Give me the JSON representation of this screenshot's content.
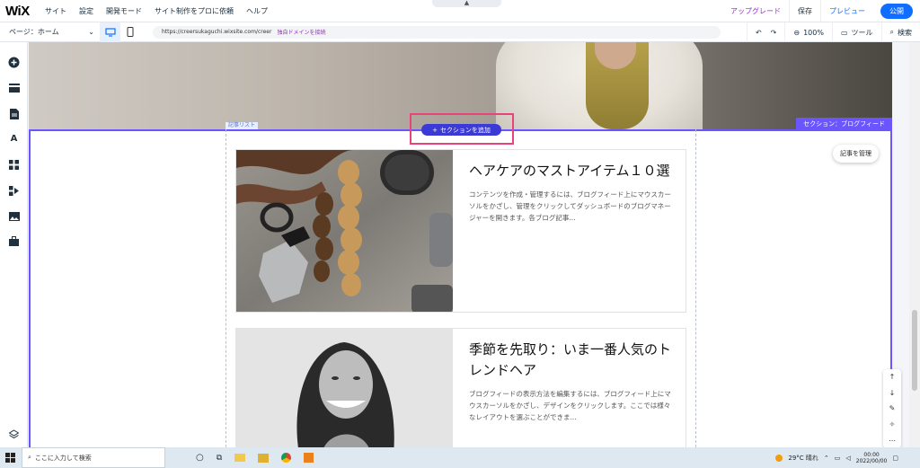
{
  "topbar": {
    "logo": "WiX",
    "menu": [
      "サイト",
      "設定",
      "開発モード",
      "サイト制作をプロに依頼",
      "ヘルプ"
    ],
    "upgrade": "アップグレード",
    "save": "保存",
    "preview": "プレビュー",
    "publish": "公開"
  },
  "subbar": {
    "page": "ページ：ホーム",
    "url": "https://creersukaguchi.wixsite.com/creer",
    "connect_domain": "独自ドメインを接続",
    "zoom": "100%",
    "tools": "ツール",
    "search": "検索"
  },
  "canvas": {
    "section_label": "セクション：ブログフィード",
    "list_label": "記事リスト",
    "add_section": "セクションを追加",
    "manage_posts": "記事を管理"
  },
  "posts": [
    {
      "title": "ヘアケアのマストアイテム１０選",
      "excerpt": "コンテンツを作成・管理するには、ブログフィード上にマウスカーソルをかざし、管理をクリックしてダッシュボードのブログマネージャーを開きます。各ブログ記事..."
    },
    {
      "title": "季節を先取り：いま一番人気のトレンドヘア",
      "excerpt": "ブログフィードの表示方法を編集するには、ブログフィード上にマウスカーソルをかざし、デザインをクリックします。ここでは様々なレイアウトを選ぶことができま..."
    }
  ],
  "taskbar": {
    "search_placeholder": "ここに入力して検索",
    "weather": "29°C 晴れ",
    "time": "00:00",
    "date": "2022/00/00"
  },
  "colors": {
    "accent": "#116dff",
    "section": "#6b55ff",
    "highlight": "#e8447a",
    "upgrade": "#9a27d5"
  }
}
